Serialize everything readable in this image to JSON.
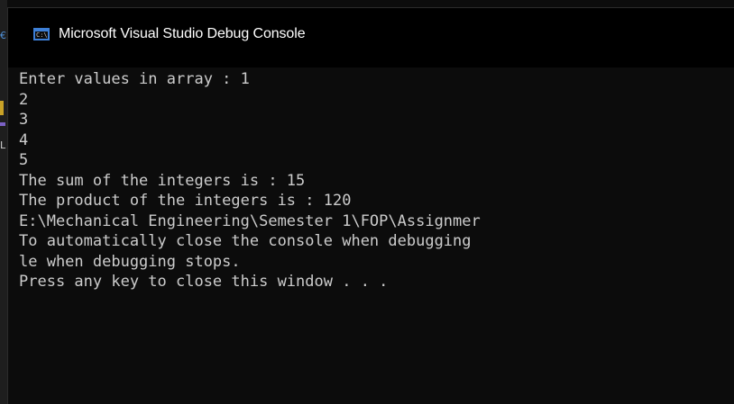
{
  "window": {
    "title": "Microsoft Visual Studio Debug Console",
    "icon": "console-app-icon",
    "icon_glyph": "C:\\"
  },
  "console": {
    "lines": [
      "Enter values in array : 1",
      "2",
      "3",
      "4",
      "5",
      "The sum of the integers is : 15",
      "The product of the integers is : 120",
      "E:\\Mechanical Engineering\\Semester 1\\FOP\\Assignmer",
      "To automatically close the console when debugging",
      "le when debugging stops.",
      "Press any key to close this window . . ."
    ]
  },
  "colors": {
    "background": "#0c0c0c",
    "titlebar": "#000000",
    "text": "#cccccc",
    "title_text": "#ffffff",
    "icon_accent": "#3d7fd6"
  },
  "ide_strip": {
    "glyphs": [
      "€",
      "L"
    ]
  }
}
